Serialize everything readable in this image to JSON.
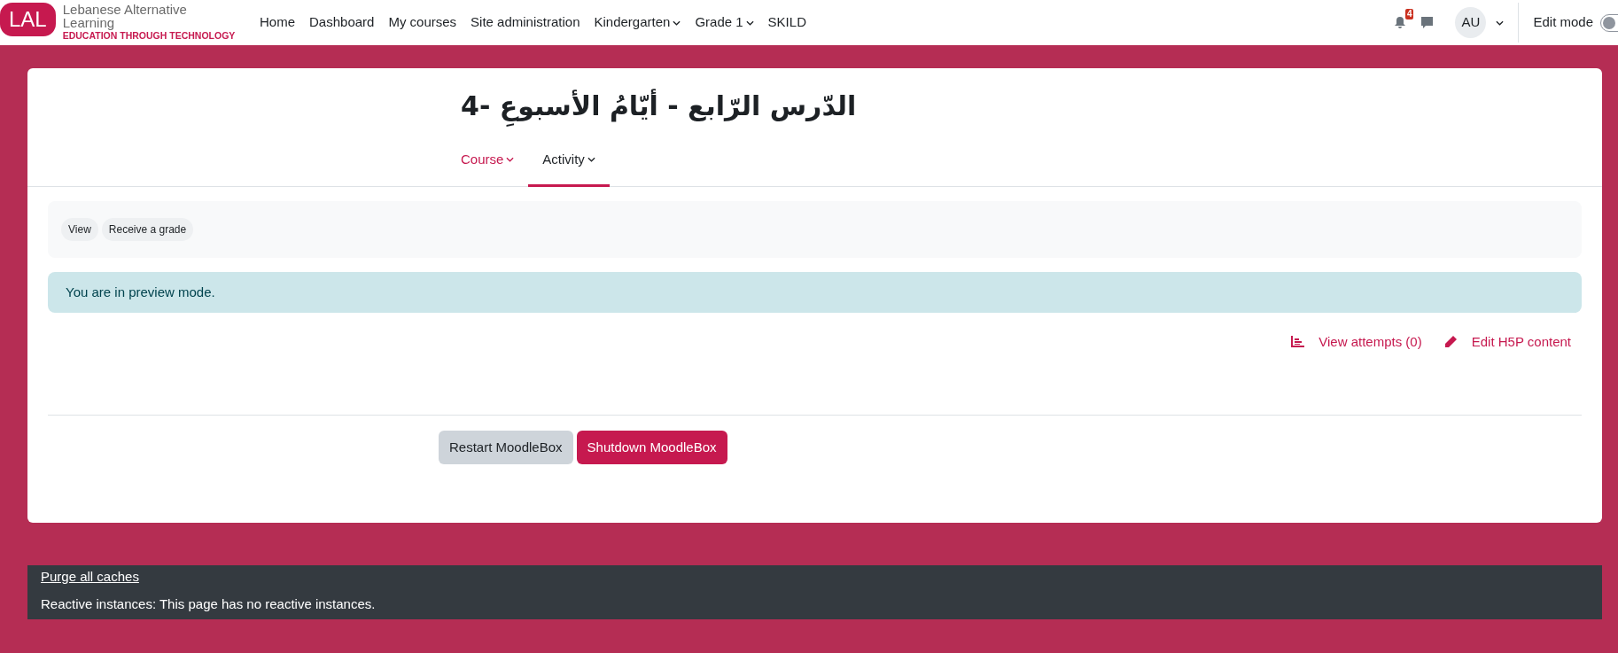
{
  "navbar": {
    "logo": {
      "initials": "LAL",
      "name_lines": [
        "Lebanese Alternative",
        "Learning"
      ],
      "tagline": "EDUCATION THROUGH TECHNOLOGY"
    },
    "items": [
      {
        "label": "Home",
        "dropdown": false
      },
      {
        "label": "Dashboard",
        "dropdown": false
      },
      {
        "label": "My courses",
        "dropdown": false
      },
      {
        "label": "Site administration",
        "dropdown": false
      },
      {
        "label": "Kindergarten",
        "dropdown": true
      },
      {
        "label": "Grade 1",
        "dropdown": true
      },
      {
        "label": "SKILD",
        "dropdown": false
      }
    ],
    "notifications": {
      "count": "4"
    },
    "user": {
      "initials": "AU"
    },
    "edit_mode": {
      "label": "Edit mode",
      "on": false
    }
  },
  "page": {
    "title": "الدّرس الرّابع - أيّامُ الأسبوعِ -4",
    "tabs": [
      {
        "label": "Course",
        "selected": false
      },
      {
        "label": "Activity",
        "selected": true
      }
    ],
    "completion": [
      "View",
      "Receive a grade"
    ],
    "alert": "You are in preview mode.",
    "actions": [
      "View attempts (0)",
      "Edit H5P content"
    ],
    "buttons": [
      {
        "label": "Restart MoodleBox",
        "kind": "secondary"
      },
      {
        "label": "Shutdown MoodleBox",
        "kind": "primary"
      }
    ]
  },
  "footer": {
    "link": "Purge all caches",
    "text": "Reactive instances: This page has no reactive instances."
  }
}
